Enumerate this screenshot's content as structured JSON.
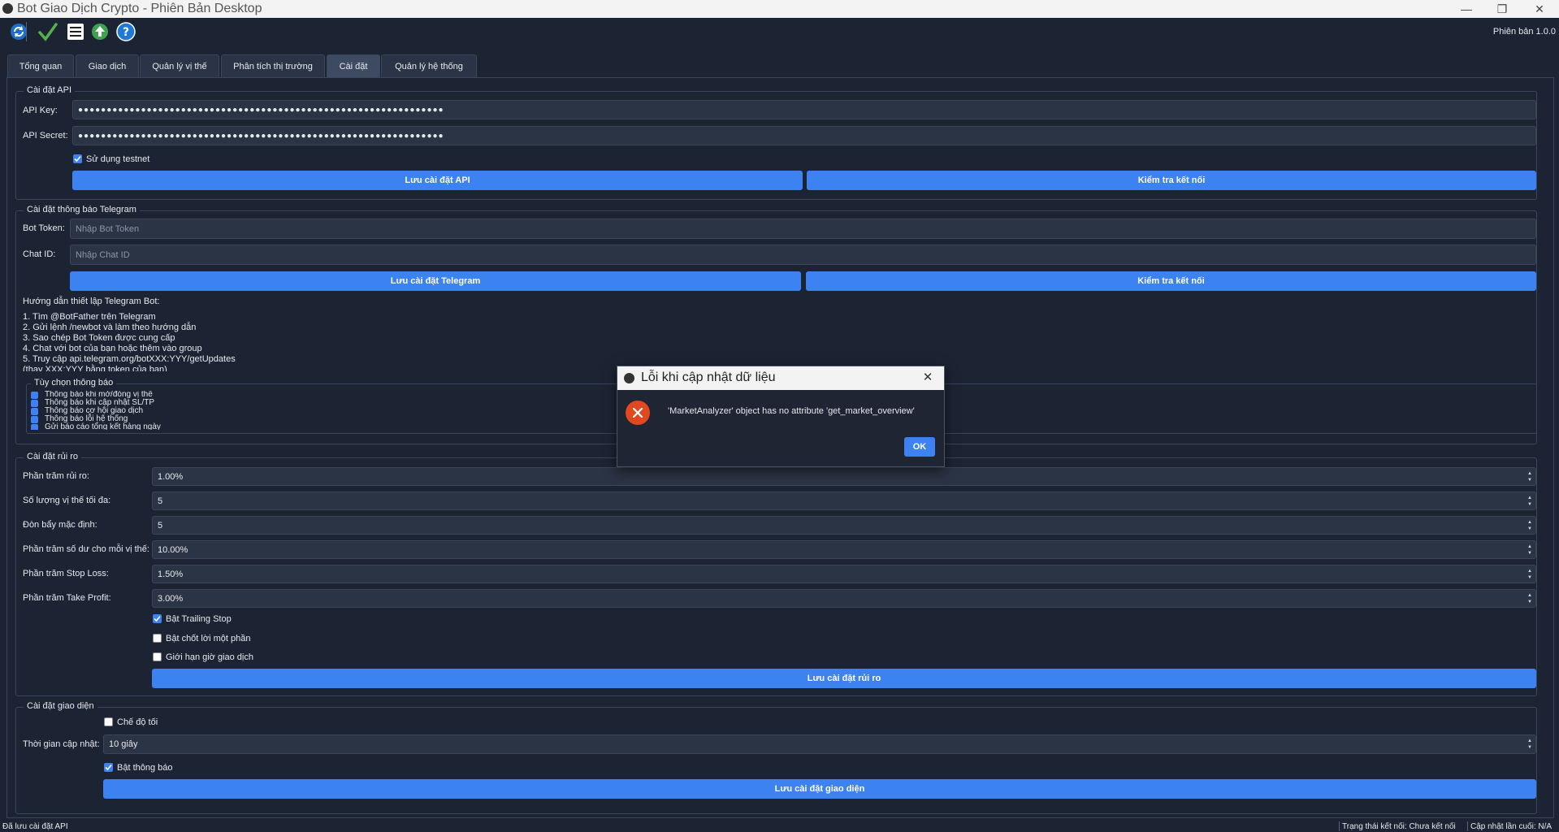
{
  "window": {
    "title": "Bot Giao Dịch Crypto - Phiên Bản Desktop",
    "minimize": "—",
    "maximize": "❐",
    "close": "✕"
  },
  "toolbar": {
    "icons": [
      "refresh-icon",
      "checkmark-icon",
      "list-icon",
      "upload-arrow-icon",
      "help-icon"
    ],
    "version": "Phiên bản 1.0.0"
  },
  "tabs": [
    {
      "label": "Tổng quan"
    },
    {
      "label": "Giao dịch"
    },
    {
      "label": "Quản lý vị thế"
    },
    {
      "label": "Phân tích thị trường"
    },
    {
      "label": "Cài đặt"
    },
    {
      "label": "Quản lý hệ thống"
    }
  ],
  "api": {
    "title": "Cài đặt API",
    "key_label": "API Key:",
    "key_value": "●●●●●●●●●●●●●●●●●●●●●●●●●●●●●●●●●●●●●●●●●●●●●●●●●●●●●●●●●●●●●●●●",
    "secret_label": "API Secret:",
    "secret_value": "●●●●●●●●●●●●●●●●●●●●●●●●●●●●●●●●●●●●●●●●●●●●●●●●●●●●●●●●●●●●●●●●",
    "testnet_label": "Sử dụng testnet",
    "testnet_checked": true,
    "save_btn": "Lưu cài đặt API",
    "test_btn": "Kiểm tra kết nối"
  },
  "telegram": {
    "title": "Cài đặt thông báo Telegram",
    "token_label": "Bot Token:",
    "token_placeholder": "Nhập Bot Token",
    "chat_label": "Chat ID:",
    "chat_placeholder": "Nhập Chat ID",
    "save_btn": "Lưu cài đặt Telegram",
    "test_btn": "Kiểm tra kết nối",
    "guide_title": "Hướng dẫn thiết lập Telegram Bot:",
    "guide": [
      "1. Tìm @BotFather trên Telegram",
      "2. Gửi lệnh /newbot và làm theo hướng dẫn",
      "3. Sao chép Bot Token được cung cấp",
      "4. Chat với bot của bạn hoặc thêm vào group",
      "5. Truy cập api.telegram.org/botXXX:YYY/getUpdates",
      "(thay XXX:YYY bằng token của bạn)"
    ],
    "options_title": "Tùy chọn thông báo",
    "options": [
      "Thông báo khi mở/đóng vị thế",
      "Thông báo khi cập nhật SL/TP",
      "Thông báo cơ hội giao dịch",
      "Thông báo lỗi hệ thống",
      "Gửi báo cáo tổng kết hàng ngày"
    ]
  },
  "risk": {
    "title": "Cài đặt rủi ro",
    "rows": [
      {
        "label": "Phần trăm rủi ro:",
        "value": "1.00%"
      },
      {
        "label": "Số lượng vị thế tối đa:",
        "value": "5"
      },
      {
        "label": "Đòn bẩy mặc định:",
        "value": "5"
      },
      {
        "label": "Phần trăm số dư cho mỗi vị thế:",
        "value": "10.00%"
      },
      {
        "label": "Phần trăm Stop Loss:",
        "value": "1.50%"
      },
      {
        "label": "Phần trăm Take Profit:",
        "value": "3.00%"
      }
    ],
    "checks": [
      {
        "label": "Bật Trailing Stop",
        "checked": true
      },
      {
        "label": "Bật chốt lời một phần",
        "checked": false
      },
      {
        "label": "Giới hạn giờ giao dịch",
        "checked": false
      }
    ],
    "save_btn": "Lưu cài đặt rủi ro"
  },
  "ui": {
    "title": "Cài đặt giao diện",
    "dark_label": "Chế độ tối",
    "dark_checked": false,
    "interval_label": "Thời gian cập nhật:",
    "interval_value": "10 giây",
    "notify_label": "Bật thông báo",
    "notify_checked": true,
    "save_btn": "Lưu cài đặt giao diện"
  },
  "dialog": {
    "title": "Lỗi khi cập nhật dữ liệu",
    "message": "'MarketAnalyzer' object has no attribute 'get_market_overview'",
    "ok": "OK",
    "close": "✕"
  },
  "status": {
    "left": "Đã lưu cài đặt API",
    "conn": "Trạng thái kết nối: Chưa kết nối",
    "update": "Cập nhật lần cuối: N/A"
  },
  "colors": {
    "accent": "#3c82f0",
    "background": "#1c2433",
    "error": "#e0491f"
  }
}
